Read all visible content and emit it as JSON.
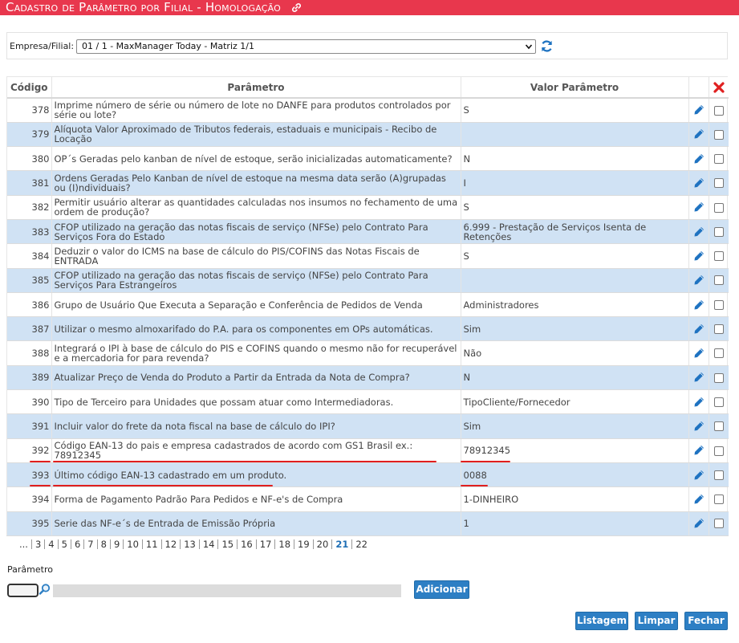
{
  "title": "Cadastro de Parâmetro por Filial   - Homologação",
  "filter": {
    "label": "Empresa/Filial:",
    "selected": "01 / 1 - MaxManager Today - Matriz 1/1"
  },
  "table": {
    "headers": {
      "code": "Código",
      "param": "Parâmetro",
      "value": "Valor Parâmetro"
    },
    "rows": [
      {
        "code": "378",
        "param": "Imprime número de série ou número de lote no DANFE para produtos controlados por série ou lote?",
        "value": "S"
      },
      {
        "code": "379",
        "param": "Alíquota Valor Aproximado de Tributos federais, estaduais e municipais - Recibo de Locação",
        "value": ""
      },
      {
        "code": "380",
        "param": "OP´s Geradas pelo kanban de nível de estoque, serão inicializadas automaticamente?",
        "value": "N"
      },
      {
        "code": "381",
        "param": "Ordens Geradas Pelo Kanban de nível de estoque na mesma data serão (A)grupadas ou (I)ndividuais?",
        "value": "I"
      },
      {
        "code": "382",
        "param": "Permitir usuário alterar as quantidades calculadas nos insumos no fechamento de uma ordem de produção?",
        "value": "S"
      },
      {
        "code": "383",
        "param": "CFOP utilizado na geração das notas fiscais de serviço (NFSe) pelo Contrato Para Serviços Fora do Estado",
        "value": "6.999 - Prestação de Serviços Isenta de Retenções"
      },
      {
        "code": "384",
        "param": "Deduzir o valor do ICMS na base de cálculo do PIS/COFINS das Notas Fiscais de ENTRADA",
        "value": "S"
      },
      {
        "code": "385",
        "param": "CFOP utilizado na geração das notas fiscais de serviço (NFSe) pelo Contrato Para Serviços Para Estrangeiros",
        "value": ""
      },
      {
        "code": "386",
        "param": "Grupo de Usuário Que Executa a Separação e Conferência de Pedidos de Venda",
        "value": "Administradores"
      },
      {
        "code": "387",
        "param": "Utilizar o mesmo almoxarifado do P.A. para os componentes em OPs automáticas.",
        "value": "Sim"
      },
      {
        "code": "388",
        "param": "Integrará o IPI à base de cálculo do PIS e COFINS quando o mesmo não for recuperável e a mercadoria for para revenda?",
        "value": "Não"
      },
      {
        "code": "389",
        "param": "Atualizar Preço de Venda do Produto a Partir da Entrada da Nota de Compra?",
        "value": "N"
      },
      {
        "code": "390",
        "param": "Tipo de Terceiro para Unidades que possam atuar como Intermediadoras.",
        "value": "TipoCliente/Fornecedor"
      },
      {
        "code": "391",
        "param": "Incluir valor do frete da nota fiscal na base de cálculo do IPI?",
        "value": "Sim"
      },
      {
        "code": "392",
        "param": "Código EAN-13 do pais e empresa cadastrados de acordo com GS1 Brasil ex.: 78912345",
        "value": "78912345"
      },
      {
        "code": "393",
        "param": "Último código EAN-13 cadastrado em um produto.",
        "value": "0088"
      },
      {
        "code": "394",
        "param": "Forma de Pagamento Padrão Para Pedidos e NF-e's de Compra",
        "value": "1-DINHEIRO"
      },
      {
        "code": "395",
        "param": "Serie das NF-e´s de Entrada de Emissão Própria",
        "value": "1"
      }
    ]
  },
  "pager": {
    "items": [
      "...",
      "3",
      "4",
      "5",
      "6",
      "7",
      "8",
      "9",
      "10",
      "11",
      "12",
      "13",
      "14",
      "15",
      "16",
      "17",
      "18",
      "19",
      "20",
      "21",
      "22"
    ],
    "active": "21"
  },
  "form": {
    "label": "Parâmetro",
    "add_label": "Adicionar"
  },
  "buttons": {
    "list": "Listagem",
    "clear": "Limpar",
    "close": "Fechar"
  },
  "colors": {
    "header_red": "#e8374d",
    "row_alt": "#d0e2f4",
    "button_blue": "#2d7fc4",
    "highlight": "#e01f1f"
  }
}
